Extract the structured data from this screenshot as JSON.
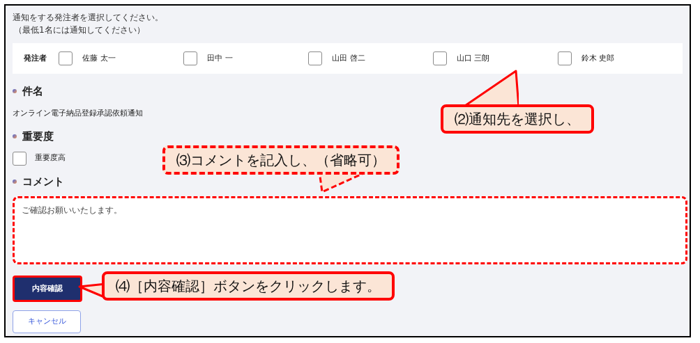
{
  "instruction": "通知をする発注者を選択してください。",
  "instruction_note": "（最低1名には通知してください）",
  "recipients": {
    "label": "発注者",
    "options": [
      {
        "name": "佐藤 太一",
        "checked": false
      },
      {
        "name": "田中 一",
        "checked": false
      },
      {
        "name": "山田 啓二",
        "checked": false
      },
      {
        "name": "山口 三朗",
        "checked": false
      },
      {
        "name": "鈴木 史郎",
        "checked": false
      }
    ]
  },
  "subject": {
    "heading": "件名",
    "value": "オンライン電子納品登録承認依頼通知"
  },
  "priority": {
    "heading": "重要度",
    "option": {
      "label": "重要度高",
      "checked": false
    }
  },
  "comment": {
    "heading": "コメント",
    "value": "ご確認お願いいたします。"
  },
  "buttons": {
    "confirm": "内容確認",
    "cancel": "キャンセル"
  },
  "callouts": [
    {
      "kind": "solid",
      "text": "⑵通知先を選択し、"
    },
    {
      "kind": "dashed",
      "text": "⑶コメントを記入し、（省略可）"
    },
    {
      "kind": "solid",
      "text": "⑷［内容確認］ボタンをクリックします。"
    }
  ]
}
